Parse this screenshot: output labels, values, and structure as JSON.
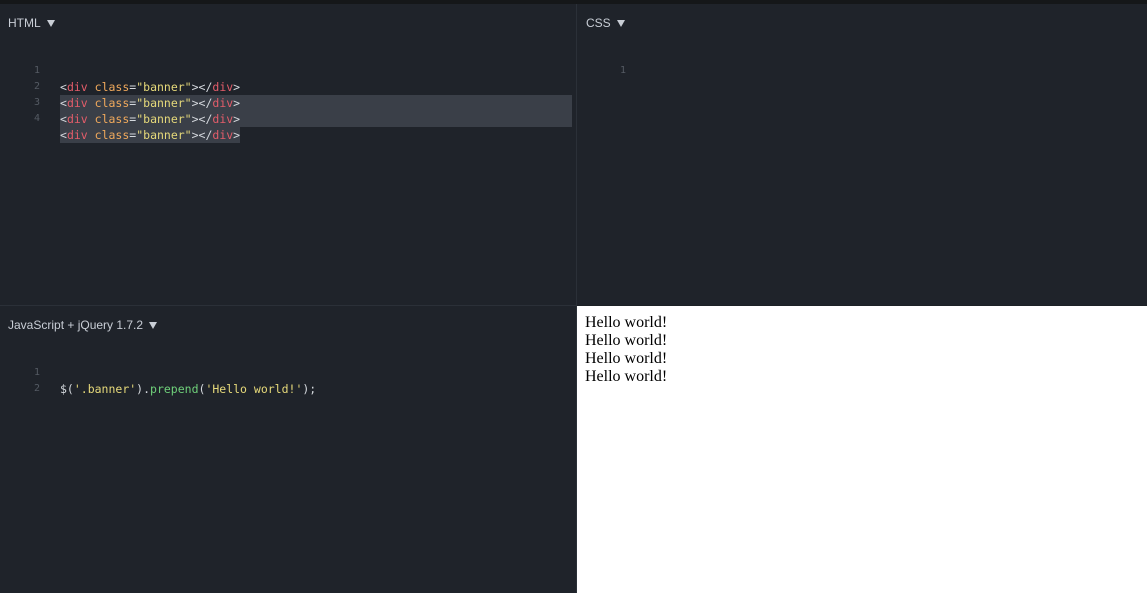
{
  "panes": {
    "html": {
      "title": "HTML",
      "lines": [
        {
          "num": "1",
          "open_bracket": "<",
          "tag": "div",
          "attr": "class",
          "eq": "=",
          "value": "\"banner\"",
          "close": "></",
          "tag2": "div",
          "end": ">"
        },
        {
          "num": "2",
          "open_bracket": "<",
          "tag": "div",
          "attr": "class",
          "eq": "=",
          "value": "\"banner\"",
          "close": "></",
          "tag2": "div",
          "end": ">"
        },
        {
          "num": "3",
          "open_bracket": "<",
          "tag": "div",
          "attr": "class",
          "eq": "=",
          "value": "\"banner\"",
          "close": "></",
          "tag2": "div",
          "end": ">"
        },
        {
          "num": "4",
          "open_bracket": "<",
          "tag": "div",
          "attr": "class",
          "eq": "=",
          "value": "\"banner\"",
          "close": "></",
          "tag2": "div",
          "end": ">"
        }
      ]
    },
    "css": {
      "title": "CSS",
      "lines": [
        {
          "num": "1"
        }
      ]
    },
    "js": {
      "title": "JavaScript + jQuery 1.7.2",
      "lines": [
        {
          "num": "1",
          "dollar": "$(",
          "selector": "'.banner'",
          "dot": ").",
          "method": "prepend",
          "paren": "(",
          "arg": "'Hello world!'",
          "end": ");"
        },
        {
          "num": "2"
        }
      ]
    },
    "result": {
      "lines": [
        "Hello world!",
        "Hello world!",
        "Hello world!",
        "Hello world!"
      ]
    }
  },
  "icons": {
    "dropdown": "caret-down-icon"
  },
  "colors": {
    "background": "#1f232a",
    "tag": "#e35d6a",
    "attribute": "#f0a95c",
    "string": "#e6d97a",
    "method": "#6fd07a",
    "selection": "#3a3f48"
  }
}
